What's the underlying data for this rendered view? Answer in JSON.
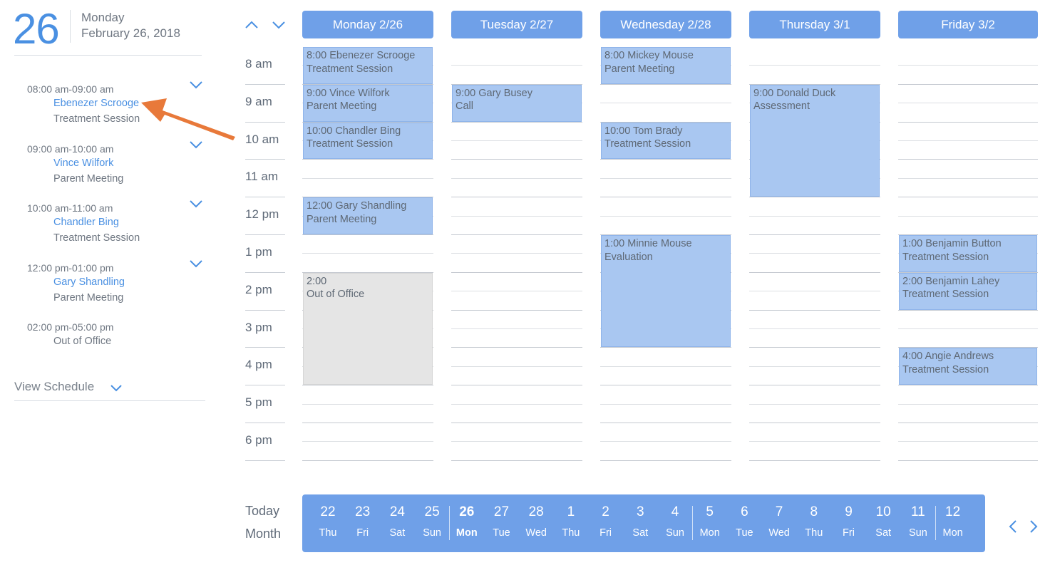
{
  "header": {
    "day_number": "26",
    "weekday": "Monday",
    "full_date": "February 26, 2018"
  },
  "agenda": [
    {
      "time": "08:00 am-09:00 am",
      "name": "Ebenezer Scrooge",
      "type": "Treatment Session",
      "expandable": true
    },
    {
      "time": "09:00 am-10:00 am",
      "name": "Vince Wilfork",
      "type": "Parent Meeting",
      "expandable": true
    },
    {
      "time": "10:00 am-11:00 am",
      "name": "Chandler Bing",
      "type": "Treatment Session",
      "expandable": true
    },
    {
      "time": "12:00 pm-01:00 pm",
      "name": "Gary Shandling",
      "type": "Parent Meeting",
      "expandable": true
    },
    {
      "time": "02:00 pm-05:00 pm",
      "name": "",
      "type": "Out of Office",
      "expandable": false
    }
  ],
  "view_schedule_label": "View Schedule",
  "hours": [
    "8 am",
    "9 am",
    "10 am",
    "11 am",
    "12 pm",
    "1 pm",
    "2 pm",
    "3 pm",
    "4 pm",
    "5 pm",
    "6 pm"
  ],
  "days": [
    {
      "label": "Monday 2/26",
      "events": [
        {
          "start": 8,
          "duration": 1,
          "line1": "8:00 Ebenezer Scrooge",
          "line2": "Treatment Session",
          "kind": "appointment"
        },
        {
          "start": 9,
          "duration": 1,
          "line1": "9:00 Vince Wilfork",
          "line2": "Parent Meeting",
          "kind": "appointment"
        },
        {
          "start": 10,
          "duration": 1,
          "line1": "10:00 Chandler Bing",
          "line2": "Treatment Session",
          "kind": "appointment"
        },
        {
          "start": 12,
          "duration": 1,
          "line1": "12:00 Gary Shandling",
          "line2": "Parent Meeting",
          "kind": "appointment"
        },
        {
          "start": 14,
          "duration": 3,
          "line1": "2:00",
          "line2": "Out of Office",
          "kind": "out-of-office"
        }
      ]
    },
    {
      "label": "Tuesday 2/27",
      "events": [
        {
          "start": 9,
          "duration": 1,
          "line1": "9:00 Gary Busey",
          "line2": "Call",
          "kind": "appointment"
        }
      ]
    },
    {
      "label": "Wednesday 2/28",
      "events": [
        {
          "start": 8,
          "duration": 1,
          "line1": "8:00 Mickey Mouse",
          "line2": "Parent Meeting",
          "kind": "appointment"
        },
        {
          "start": 10,
          "duration": 1,
          "line1": "10:00 Tom Brady",
          "line2": "Treatment Session",
          "kind": "appointment"
        },
        {
          "start": 13,
          "duration": 3,
          "line1": "1:00 Minnie Mouse",
          "line2": "Evaluation",
          "kind": "appointment"
        }
      ]
    },
    {
      "label": "Thursday 3/1",
      "events": [
        {
          "start": 9,
          "duration": 3,
          "line1": "9:00 Donald Duck",
          "line2": "Assessment",
          "kind": "appointment"
        }
      ]
    },
    {
      "label": "Friday 3/2",
      "events": [
        {
          "start": 13,
          "duration": 1,
          "line1": "1:00 Benjamin Button",
          "line2": "Treatment Session",
          "kind": "appointment"
        },
        {
          "start": 14,
          "duration": 1,
          "line1": "2:00 Benjamin Lahey",
          "line2": "Treatment Session",
          "kind": "appointment"
        },
        {
          "start": 16,
          "duration": 1,
          "line1": "4:00 Angie Andrews",
          "line2": "Treatment Session",
          "kind": "appointment"
        }
      ]
    }
  ],
  "bottom": {
    "today_label": "Today",
    "month_label": "Month",
    "strip": [
      {
        "n": "22",
        "w": "Thu"
      },
      {
        "n": "23",
        "w": "Fri"
      },
      {
        "n": "24",
        "w": "Sat"
      },
      {
        "n": "25",
        "w": "Sun"
      },
      {
        "n": "26",
        "w": "Mon",
        "selected": true
      },
      {
        "n": "27",
        "w": "Tue"
      },
      {
        "n": "28",
        "w": "Wed"
      },
      {
        "n": "1",
        "w": "Thu"
      },
      {
        "n": "2",
        "w": "Fri"
      },
      {
        "n": "3",
        "w": "Sat"
      },
      {
        "n": "4",
        "w": "Sun"
      },
      {
        "n": "5",
        "w": "Mon"
      },
      {
        "n": "6",
        "w": "Tue"
      },
      {
        "n": "7",
        "w": "Wed"
      },
      {
        "n": "8",
        "w": "Thu"
      },
      {
        "n": "9",
        "w": "Fri"
      },
      {
        "n": "10",
        "w": "Sat"
      },
      {
        "n": "11",
        "w": "Sun"
      },
      {
        "n": "12",
        "w": "Mon"
      }
    ]
  },
  "icons": {
    "nav_up": "chevron-up-icon",
    "nav_down": "chevron-down-icon",
    "prev": "chevron-left-icon",
    "next": "chevron-right-icon",
    "annotation": "arrow-annotation"
  },
  "colors": {
    "accent": "#4a90e2",
    "header_blue": "#6fa0e8",
    "appointment": "#a9c7f1",
    "out_of_office": "#e5e5e5",
    "annotation_arrow": "#e8793a"
  }
}
